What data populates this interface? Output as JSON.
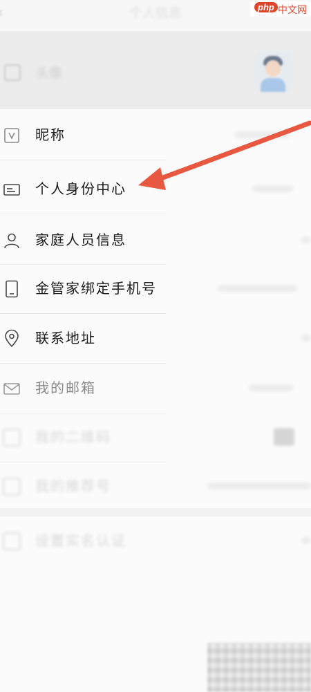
{
  "header": {
    "title": "个人信息",
    "back_icon": "chevron-left-icon"
  },
  "avatar_row": {
    "label": "头像",
    "icon": "photo-icon"
  },
  "items": [
    {
      "label": "昵称",
      "icon": "v-badge-icon"
    },
    {
      "label": "个人身份中心",
      "icon": "id-card-icon"
    },
    {
      "label": "家庭人员信息",
      "icon": "person-icon"
    },
    {
      "label": "金管家绑定手机号",
      "icon": "phone-icon"
    },
    {
      "label": "联系地址",
      "icon": "location-pin-icon"
    },
    {
      "label": "我的邮箱",
      "icon": "mail-icon"
    },
    {
      "label": "我的二维码",
      "icon": "qrcode-icon"
    },
    {
      "label": "我的推荐号",
      "icon": "referral-icon"
    },
    {
      "label": "设置实名认证",
      "icon": "verify-icon"
    }
  ],
  "watermark": {
    "badge": "php",
    "text": "中文网"
  },
  "colors": {
    "annotation_arrow": "#e8573f",
    "text": "#1a1a1a"
  }
}
